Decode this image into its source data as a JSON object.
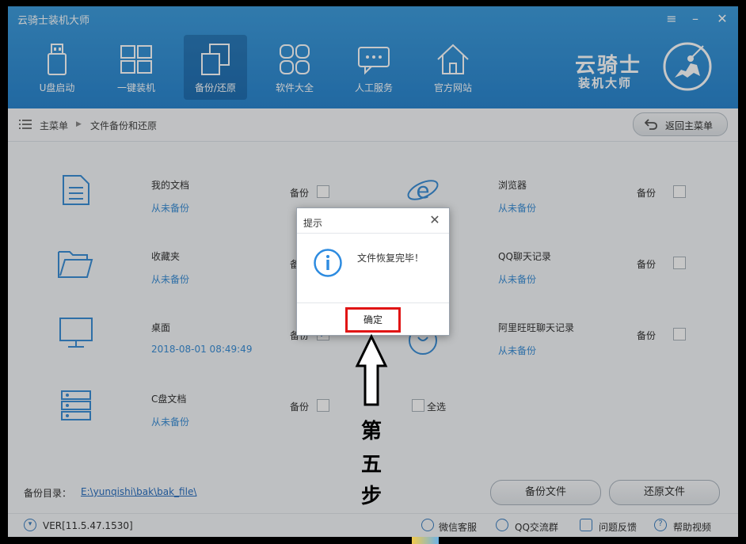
{
  "window": {
    "title": "云骑士装机大师",
    "controls": {
      "menu_icon": "menu-icon",
      "minimize_icon": "minimize-icon",
      "close_icon": "close-icon"
    }
  },
  "logo": {
    "line1": "云骑士",
    "line2": "装机大师"
  },
  "nav": [
    {
      "label": "U盘启动",
      "icon": "usb-icon"
    },
    {
      "label": "一键装机",
      "icon": "windows-icon"
    },
    {
      "label": "备份/还原",
      "icon": "backup-icon",
      "active": true
    },
    {
      "label": "软件大全",
      "icon": "apps-icon"
    },
    {
      "label": "人工服务",
      "icon": "chat-icon"
    },
    {
      "label": "官方网站",
      "icon": "home-icon"
    }
  ],
  "breadcrumb": {
    "root": "主菜单",
    "current": "文件备份和还原",
    "back_label": "返回主菜单"
  },
  "items": {
    "documents": {
      "name": "我的文档",
      "status": "从未备份",
      "backup_label": "备份",
      "checked": false
    },
    "favorites": {
      "name": "收藏夹",
      "status": "从未备份",
      "backup_label": "备份",
      "checked": false
    },
    "desktop": {
      "name": "桌面",
      "status": "2018-08-01 08:49:49",
      "backup_label": "备份",
      "checked": true
    },
    "c_docs": {
      "name": "C盘文档",
      "status": "从未备份",
      "backup_label": "备份",
      "checked": false
    },
    "browser": {
      "name": "浏览器",
      "status": "从未备份",
      "backup_label": "备份",
      "checked": false
    },
    "qq": {
      "name": "QQ聊天记录",
      "status": "从未备份",
      "backup_label": "备份",
      "checked": false
    },
    "aliwangwang": {
      "name": "阿里旺旺聊天记录",
      "status": "从未备份",
      "backup_label": "备份",
      "checked": false
    }
  },
  "select_all": "全选",
  "backup_dir": {
    "label": "备份目录：",
    "path": "E:\\yunqishi\\bak\\bak_file\\"
  },
  "buttons": {
    "backup_files": "备份文件",
    "restore_files": "还原文件"
  },
  "footer": {
    "version": "VER[11.5.47.1530]",
    "links": [
      "微信客服",
      "QQ交流群",
      "问题反馈",
      "帮助视频"
    ]
  },
  "dialog": {
    "title": "提示",
    "message": "文件恢复完毕！",
    "ok_label": "确定"
  },
  "annotation": {
    "chars": [
      "第",
      "五",
      "步"
    ]
  },
  "colors": {
    "header": "#2b86cf",
    "accent": "#3c8fd6",
    "highlight": "#e01515"
  }
}
